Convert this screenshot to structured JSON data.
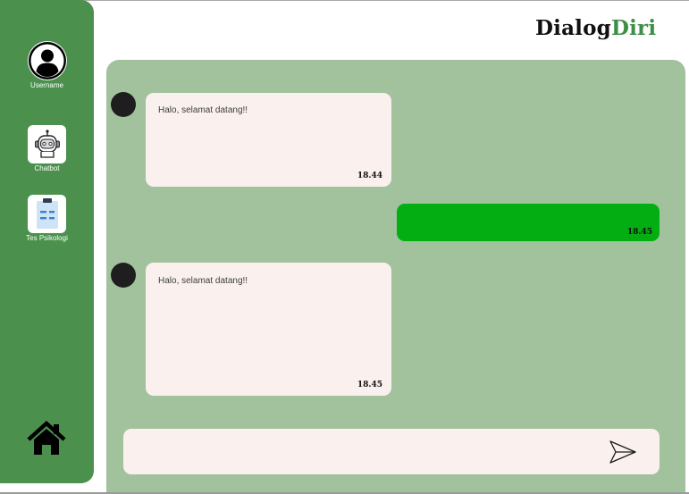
{
  "app": {
    "logo_part1": "Dialog",
    "logo_part2": "Diri"
  },
  "sidebar": {
    "profile_label": "Username",
    "items": [
      {
        "label": "Chatbot",
        "icon": "robot-icon"
      },
      {
        "label": "Tes Psikologi",
        "icon": "clipboard-icon"
      }
    ],
    "home_icon": "home-icon"
  },
  "chat": {
    "messages": [
      {
        "sender": "bot",
        "text": "Halo, selamat datang!!",
        "time": "18.44"
      },
      {
        "sender": "user",
        "text": "",
        "time": "18.45"
      },
      {
        "sender": "bot",
        "text": "Halo, selamat datang!!",
        "time": "18.45"
      }
    ]
  },
  "composer": {
    "value": "",
    "placeholder": "",
    "send_icon": "send-icon"
  },
  "colors": {
    "sidebar": "#4b914d",
    "panel": "#a2c29e",
    "bubble": "#faf1ee",
    "user_bubble": "#02ae12",
    "logo_accent": "#3d8f47"
  }
}
